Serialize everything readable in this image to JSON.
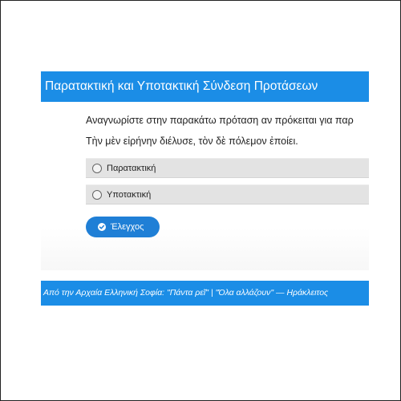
{
  "header": {
    "title": "Παρατακτική και Υποτακτική Σύνδεση Προτάσεων"
  },
  "quiz": {
    "question": "Αναγνωρίστε στην παρακάτω πρόταση αν πρόκειται για παρ",
    "sentence": "Τὴν μὲν εἰρήνην διέλυσε, τὸν δὲ πόλεμον ἐποίει.",
    "options": [
      {
        "label": "Παρατακτική",
        "selected": false
      },
      {
        "label": "Υποτακτική",
        "selected": false
      }
    ],
    "check_button": {
      "label": "Έλεγχος",
      "icon": "check-circle-icon"
    }
  },
  "footer": {
    "text": "Από την Αρχαία Ελληνική Σοφία: \"Πάντα ρεῖ\" | \"Όλα αλλάζουν\" — Ηράκλειτος"
  },
  "colors": {
    "header_bg": "#1b8de6",
    "footer_bg": "#1b8de6",
    "button_bg": "#1f7fd6",
    "option_bg": "#e3e3e3"
  }
}
